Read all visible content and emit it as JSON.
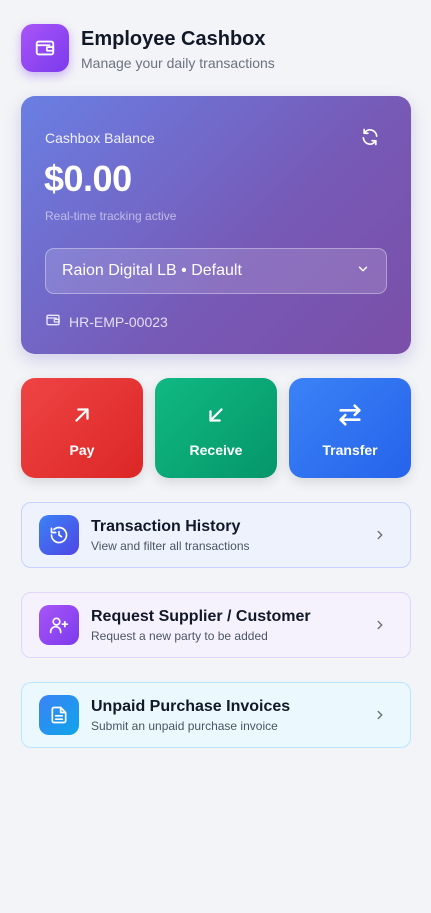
{
  "header": {
    "title": "Employee Cashbox",
    "subtitle": "Manage your daily transactions",
    "icon": "wallet-icon"
  },
  "balance": {
    "label": "Cashbox Balance",
    "amount": "$0.00",
    "status": "Real-time tracking active",
    "selected_cashbox": "Raion Digital LB • Default",
    "employee_id": "HR-EMP-00023"
  },
  "actions": [
    {
      "label": "Pay",
      "icon": "arrow-up-right-icon",
      "color": "#ef4444"
    },
    {
      "label": "Receive",
      "icon": "arrow-down-left-icon",
      "color": "#10b981"
    },
    {
      "label": "Transfer",
      "icon": "swap-arrows-icon",
      "color": "#3b82f6"
    }
  ],
  "menu": [
    {
      "title": "Transaction History",
      "subtitle": "View and filter all transactions",
      "icon": "history-icon"
    },
    {
      "title": "Request Supplier / Customer",
      "subtitle": "Request a new party to be added",
      "icon": "user-plus-icon"
    },
    {
      "title": "Unpaid Purchase Invoices",
      "subtitle": "Submit an unpaid purchase invoice",
      "icon": "document-icon"
    }
  ],
  "colors": {
    "accent_purple": "#7c3aed",
    "card_gradient_start": "#6a7fe3",
    "card_gradient_end": "#7a4fa8",
    "background": "#f3f4f7"
  }
}
